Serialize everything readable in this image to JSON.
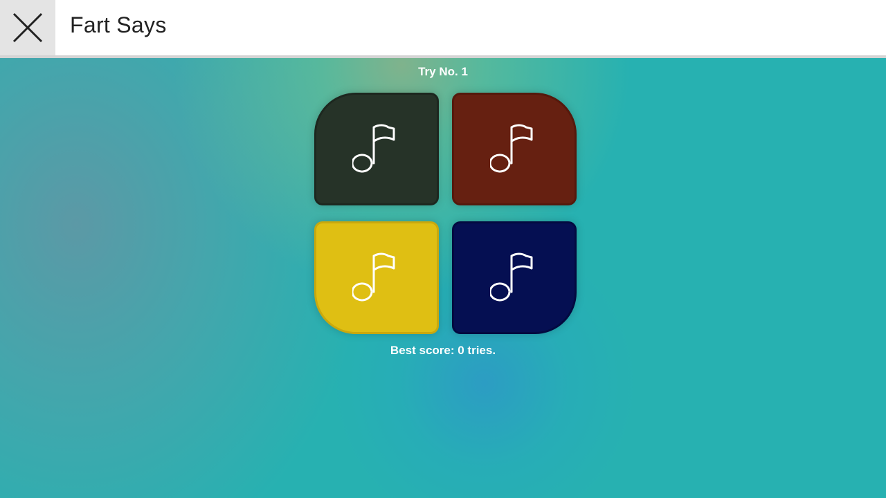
{
  "header": {
    "title": "Fart Says",
    "close_icon": "close-icon"
  },
  "game": {
    "try_label": "Try No. 1",
    "best_score_label": "Best score: 0 tries.",
    "pads": [
      {
        "name": "green",
        "color": "#263328",
        "icon": "music-note-icon"
      },
      {
        "name": "red",
        "color": "#662011",
        "icon": "music-note-icon"
      },
      {
        "name": "yellow",
        "color": "#dfbf13",
        "icon": "music-note-icon"
      },
      {
        "name": "blue",
        "color": "#050f52",
        "icon": "music-note-icon"
      }
    ]
  },
  "colors": {
    "background": "#27b1b1",
    "header_background": "#ffffff",
    "close_button_background": "#e4e4e4"
  }
}
